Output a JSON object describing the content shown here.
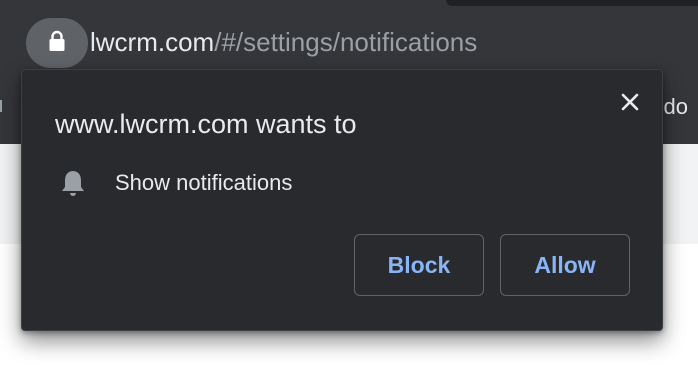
{
  "address_bar": {
    "host": "lwcrm.com",
    "path": "/#/settings/notifications",
    "lock_icon": "lock-icon"
  },
  "bookmark_bar": {
    "partial_text": "do"
  },
  "permission_popup": {
    "title": "www.lwcrm.com wants to",
    "close_icon": "close-icon",
    "permission": {
      "icon": "bell-icon",
      "label": "Show notifications"
    },
    "buttons": {
      "block_label": "Block",
      "allow_label": "Allow"
    }
  },
  "colors": {
    "toolbar_bg": "#35363a",
    "popup_bg": "#292a2d",
    "button_text": "#8ab4f8",
    "primary_text": "#e8eaed",
    "secondary_text": "#9aa0a6"
  }
}
